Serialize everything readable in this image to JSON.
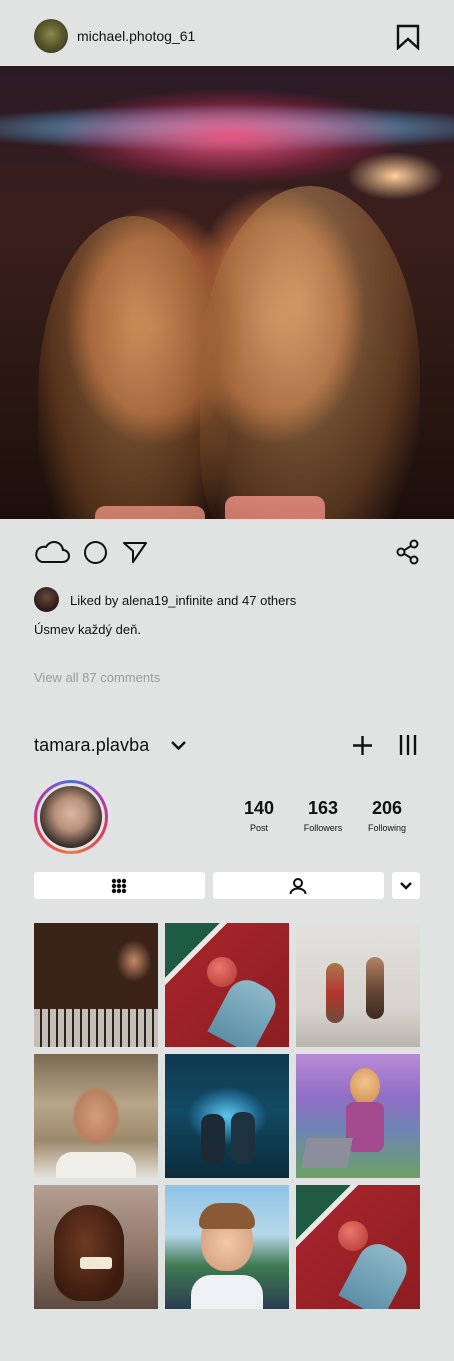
{
  "post": {
    "username": "michael.photog_61",
    "likes_text": "Liked by alena19_infinite and 47 others",
    "caption": "Úsmev každý deň.",
    "view_comments": "View all 87 comments"
  },
  "profile": {
    "username": "tamara.plavba",
    "stats": [
      {
        "value": "140",
        "label": "Post"
      },
      {
        "value": "163",
        "label": "Followers"
      },
      {
        "value": "206",
        "label": "Following"
      }
    ]
  },
  "grid": [
    {
      "name": "grid-photo-man-piano"
    },
    {
      "name": "grid-photo-tennis-ball-hand"
    },
    {
      "name": "grid-photo-dancers-jumping"
    },
    {
      "name": "grid-photo-smiling-woman-kitchen"
    },
    {
      "name": "grid-photo-neon-street-couple"
    },
    {
      "name": "grid-photo-game-character-city"
    },
    {
      "name": "grid-photo-laughing-horse"
    },
    {
      "name": "grid-photo-smiling-boy"
    },
    {
      "name": "grid-photo-tennis-ball-hand-2"
    }
  ],
  "colors": {
    "background": "#e1e3e2",
    "ring_gradient": [
      "#4b6fd8",
      "#b338a8",
      "#e13a5c",
      "#f07a3a"
    ],
    "muted_text": "#9a9b9b"
  },
  "icons": [
    "bookmark-icon",
    "cloud-icon",
    "circle-icon",
    "send-icon",
    "share-icon",
    "chevron-down-icon",
    "plus-icon",
    "menu-lines-icon",
    "grid-icon",
    "person-icon"
  ]
}
